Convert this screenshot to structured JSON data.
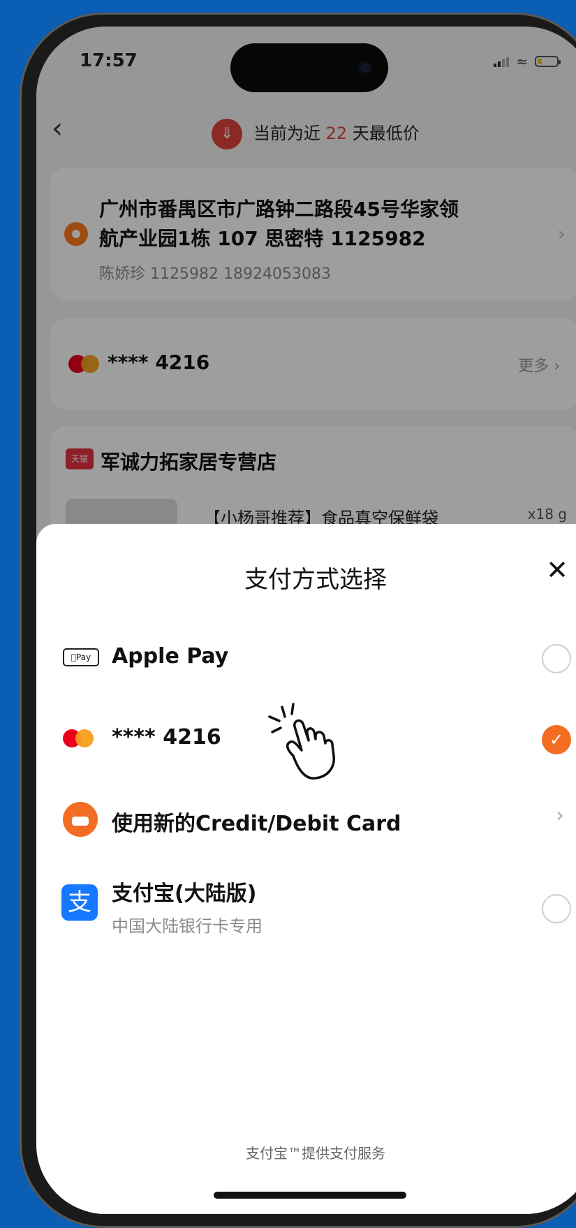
{
  "status_bar": {
    "time": "17:57"
  },
  "nav": {
    "back_icon": "chevron-left-icon",
    "tip_prefix": "当前为近",
    "tip_days": "22",
    "tip_suffix": "天最低价",
    "tip_icon": "price-down-icon"
  },
  "address": {
    "line1": "广州市番禺区市广路钟二路段45号华家领",
    "line2": "航产业园1栋 107 思密特 1125982",
    "contact": "陈娇珍 1125982 18924053083"
  },
  "payment_card": {
    "number": "**** 4216",
    "more_label": "更多"
  },
  "store": {
    "badge": "天猫",
    "name": "军诚力拓家居专营店",
    "product_title": "【小杨哥推荐】食品真空保鲜袋",
    "product_qty": "x18 g"
  },
  "sheet": {
    "title": "支付方式选择",
    "close_icon": "close-icon",
    "options": [
      {
        "label": "Apple Pay",
        "icon": "apple-pay-icon",
        "selected": false
      },
      {
        "label": "**** 4216",
        "icon": "mastercard-icon",
        "selected": true
      },
      {
        "label": "使用新的Credit/Debit Card",
        "icon": "credit-card-icon"
      },
      {
        "label": "支付宝(大陆版)",
        "sublabel": "中国大陆银行卡专用",
        "icon": "alipay-icon",
        "selected": false
      }
    ],
    "footer": "支付宝™提供支付服务"
  },
  "colors": {
    "accent": "#f26d21",
    "background": "#0a5fb4",
    "alipay": "#1677ff",
    "price_red": "#e0443a"
  }
}
